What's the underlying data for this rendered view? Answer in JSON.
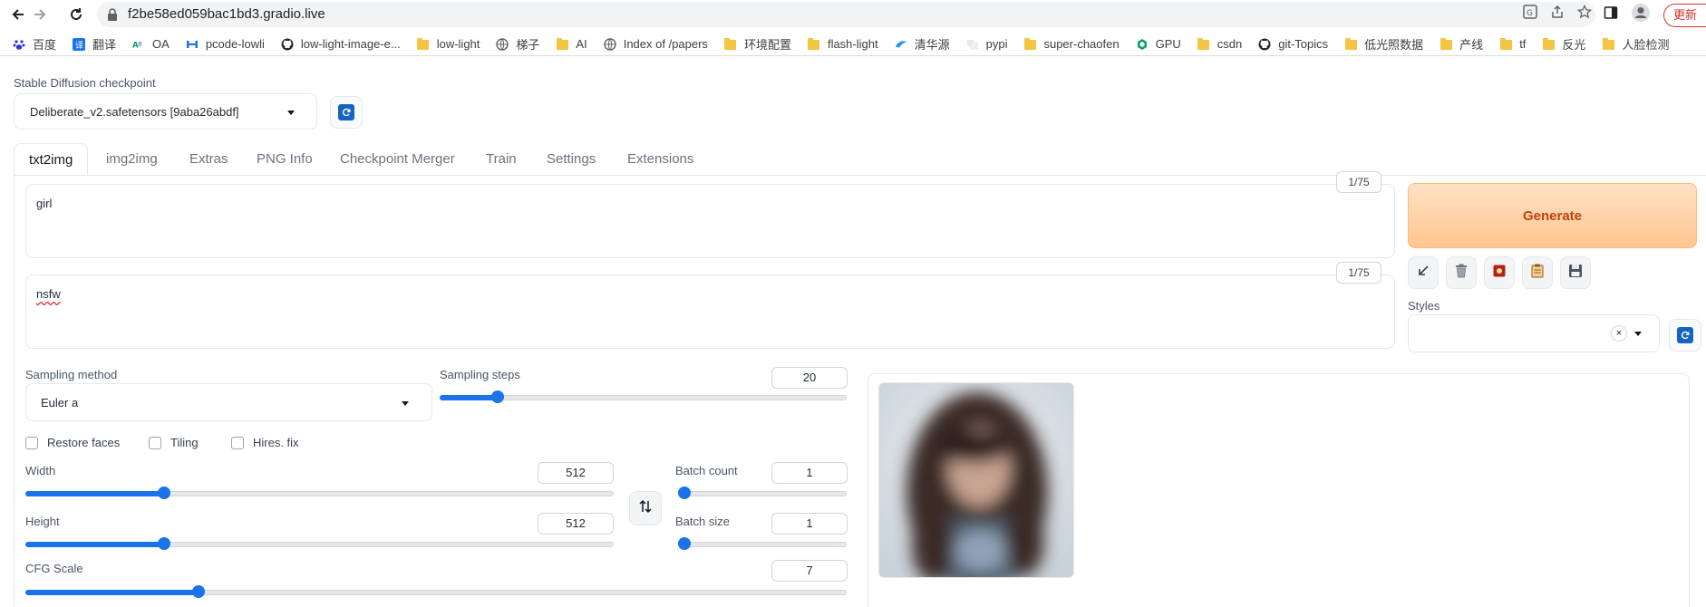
{
  "browser": {
    "url": "f2be58ed059bac1bd3.gradio.live",
    "update_label": "更新",
    "bookmarks": [
      {
        "label": "百度",
        "icon": "baidu-icon"
      },
      {
        "label": "翻译",
        "icon": "translate-icon"
      },
      {
        "label": "OA",
        "icon": "oa-icon"
      },
      {
        "label": "pcode-lowli",
        "icon": "pcode-icon"
      },
      {
        "label": "low-light-image-e...",
        "icon": "github-icon"
      },
      {
        "label": "low-light",
        "icon": "folder-icon"
      },
      {
        "label": "梯子",
        "icon": "globe-icon"
      },
      {
        "label": "AI",
        "icon": "folder-icon"
      },
      {
        "label": "Index of /papers",
        "icon": "globe-icon"
      },
      {
        "label": "环境配置",
        "icon": "folder-icon"
      },
      {
        "label": "flash-light",
        "icon": "folder-icon"
      },
      {
        "label": "清华源",
        "icon": "tsinghua-icon"
      },
      {
        "label": "pypi",
        "icon": "pypi-icon"
      },
      {
        "label": "super-chaofen",
        "icon": "folder-icon"
      },
      {
        "label": "GPU",
        "icon": "gpu-icon"
      },
      {
        "label": "csdn",
        "icon": "folder-icon"
      },
      {
        "label": "git-Topics",
        "icon": "github-icon"
      },
      {
        "label": "低光照数据",
        "icon": "folder-icon"
      },
      {
        "label": "产线",
        "icon": "folder-icon"
      },
      {
        "label": "tf",
        "icon": "folder-icon"
      },
      {
        "label": "反光",
        "icon": "folder-icon"
      },
      {
        "label": "人脸检测",
        "icon": "folder-icon"
      }
    ]
  },
  "checkpoint": {
    "label": "Stable Diffusion checkpoint",
    "value": "Deliberate_v2.safetensors [9aba26abdf]"
  },
  "tabs": [
    {
      "label": "txt2img",
      "active": true
    },
    {
      "label": "img2img",
      "active": false
    },
    {
      "label": "Extras",
      "active": false
    },
    {
      "label": "PNG Info",
      "active": false
    },
    {
      "label": "Checkpoint Merger",
      "active": false
    },
    {
      "label": "Train",
      "active": false
    },
    {
      "label": "Settings",
      "active": false
    },
    {
      "label": "Extensions",
      "active": false
    }
  ],
  "prompt": {
    "text": "girl",
    "tokens": "1/75"
  },
  "negative_prompt": {
    "text": "nsfw",
    "tokens": "1/75"
  },
  "generate_label": "Generate",
  "styles": {
    "label": "Styles",
    "clear": "×"
  },
  "sampling": {
    "method_label": "Sampling method",
    "method_value": "Euler a",
    "steps_label": "Sampling steps",
    "steps_value": "20",
    "steps_fraction": 0.14
  },
  "checkboxes": {
    "restore_faces": "Restore faces",
    "tiling": "Tiling",
    "hires_fix": "Hires. fix"
  },
  "width": {
    "label": "Width",
    "value": "512",
    "fraction": 0.235
  },
  "height": {
    "label": "Height",
    "value": "512",
    "fraction": 0.235
  },
  "batch_count": {
    "label": "Batch count",
    "value": "1",
    "fraction": 0.0
  },
  "batch_size": {
    "label": "Batch size",
    "value": "1",
    "fraction": 0.0
  },
  "cfg": {
    "label": "CFG Scale",
    "value": "7",
    "fraction": 0.21
  },
  "colors": {
    "accent": "#1a73e8",
    "generate_text": "#c2410c",
    "generate_bg": "#ffc58f"
  }
}
